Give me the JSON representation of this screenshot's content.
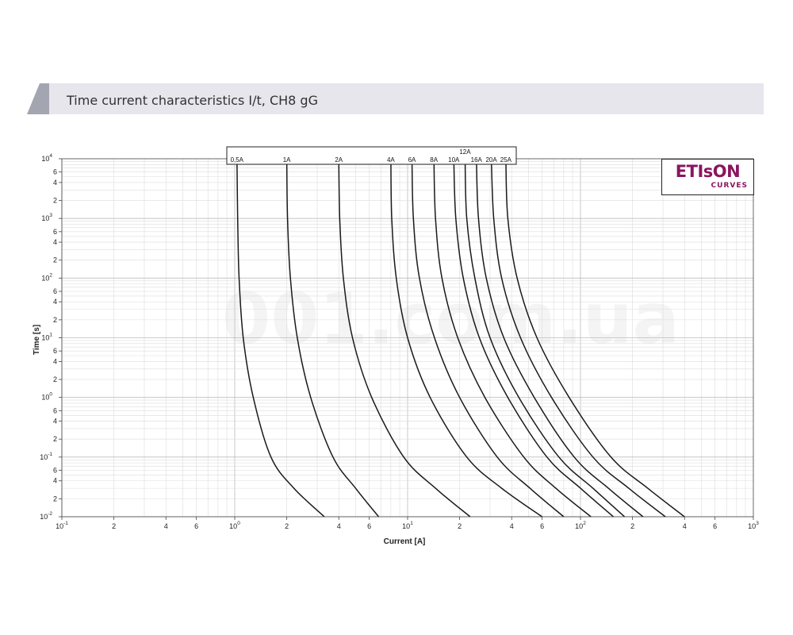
{
  "header": {
    "title": "Time current characteristics I/t, CH8 gG"
  },
  "logo": {
    "main": "ETIsON",
    "sub": "CURVES"
  },
  "watermark": "001.com.ua",
  "colors": {
    "header_bar": "#e6e6ec",
    "header_slant": "#a3a5b0",
    "curve": "#1a1a1a",
    "grid": "#dcdcdc",
    "logo": "#8a1560"
  },
  "chart_data": {
    "type": "line",
    "title": "",
    "xlabel": "Current [A]",
    "ylabel": "Time [s]",
    "xscale": "log",
    "yscale": "log",
    "xlim": [
      0.1,
      1000
    ],
    "ylim": [
      0.01,
      10000
    ],
    "grid": true,
    "x_ticks": [
      {
        "v": 0.1,
        "mant": "10",
        "exp": "-1"
      },
      {
        "v": 0.2,
        "mant": "2",
        "exp": ""
      },
      {
        "v": 0.4,
        "mant": "4",
        "exp": ""
      },
      {
        "v": 0.6,
        "mant": "6",
        "exp": ""
      },
      {
        "v": 1,
        "mant": "10",
        "exp": "0"
      },
      {
        "v": 2,
        "mant": "2",
        "exp": ""
      },
      {
        "v": 4,
        "mant": "4",
        "exp": ""
      },
      {
        "v": 6,
        "mant": "6",
        "exp": ""
      },
      {
        "v": 10,
        "mant": "10",
        "exp": "1"
      },
      {
        "v": 20,
        "mant": "2",
        "exp": ""
      },
      {
        "v": 40,
        "mant": "4",
        "exp": ""
      },
      {
        "v": 60,
        "mant": "6",
        "exp": ""
      },
      {
        "v": 100,
        "mant": "10",
        "exp": "2"
      },
      {
        "v": 200,
        "mant": "2",
        "exp": ""
      },
      {
        "v": 400,
        "mant": "4",
        "exp": ""
      },
      {
        "v": 600,
        "mant": "6",
        "exp": ""
      },
      {
        "v": 1000,
        "mant": "10",
        "exp": "3"
      }
    ],
    "y_ticks": [
      {
        "v": 0.01,
        "mant": "10",
        "exp": "-2"
      },
      {
        "v": 0.02,
        "mant": "2",
        "exp": ""
      },
      {
        "v": 0.04,
        "mant": "4",
        "exp": ""
      },
      {
        "v": 0.06,
        "mant": "6",
        "exp": ""
      },
      {
        "v": 0.1,
        "mant": "10",
        "exp": "-1"
      },
      {
        "v": 0.2,
        "mant": "2",
        "exp": ""
      },
      {
        "v": 0.4,
        "mant": "4",
        "exp": ""
      },
      {
        "v": 0.6,
        "mant": "6",
        "exp": ""
      },
      {
        "v": 1,
        "mant": "10",
        "exp": "0"
      },
      {
        "v": 2,
        "mant": "2",
        "exp": ""
      },
      {
        "v": 4,
        "mant": "4",
        "exp": ""
      },
      {
        "v": 6,
        "mant": "6",
        "exp": ""
      },
      {
        "v": 10,
        "mant": "10",
        "exp": "1"
      },
      {
        "v": 20,
        "mant": "2",
        "exp": ""
      },
      {
        "v": 40,
        "mant": "4",
        "exp": ""
      },
      {
        "v": 60,
        "mant": "6",
        "exp": ""
      },
      {
        "v": 100,
        "mant": "10",
        "exp": "2"
      },
      {
        "v": 200,
        "mant": "2",
        "exp": ""
      },
      {
        "v": 400,
        "mant": "4",
        "exp": ""
      },
      {
        "v": 600,
        "mant": "6",
        "exp": ""
      },
      {
        "v": 1000,
        "mant": "10",
        "exp": "3"
      },
      {
        "v": 2000,
        "mant": "2",
        "exp": ""
      },
      {
        "v": 4000,
        "mant": "4",
        "exp": ""
      },
      {
        "v": 6000,
        "mant": "6",
        "exp": ""
      },
      {
        "v": 10000,
        "mant": "10",
        "exp": "4"
      }
    ],
    "series": [
      {
        "name": "0,5A",
        "label_row": 0,
        "points": [
          [
            1.03,
            10000
          ],
          [
            1.04,
            1000
          ],
          [
            1.06,
            100
          ],
          [
            1.12,
            10
          ],
          [
            1.28,
            1
          ],
          [
            1.62,
            0.1
          ],
          [
            2.2,
            0.03
          ],
          [
            3.3,
            0.01
          ]
        ]
      },
      {
        "name": "1A",
        "label_row": 0,
        "points": [
          [
            2.0,
            10000
          ],
          [
            2.02,
            1000
          ],
          [
            2.1,
            100
          ],
          [
            2.3,
            10
          ],
          [
            2.75,
            1
          ],
          [
            3.7,
            0.1
          ],
          [
            5.0,
            0.03
          ],
          [
            6.8,
            0.01
          ]
        ]
      },
      {
        "name": "2A",
        "label_row": 0,
        "points": [
          [
            4.0,
            10000
          ],
          [
            4.05,
            1000
          ],
          [
            4.25,
            100
          ],
          [
            4.8,
            10
          ],
          [
            6.2,
            1
          ],
          [
            9.5,
            0.1
          ],
          [
            14.5,
            0.03
          ],
          [
            23,
            0.01
          ]
        ]
      },
      {
        "name": "4A",
        "label_row": 0,
        "points": [
          [
            8.0,
            10000
          ],
          [
            8.1,
            1000
          ],
          [
            8.6,
            100
          ],
          [
            10,
            10
          ],
          [
            13.5,
            1
          ],
          [
            22,
            0.1
          ],
          [
            35,
            0.03
          ],
          [
            60,
            0.01
          ]
        ]
      },
      {
        "name": "6A",
        "label_row": 0,
        "points": [
          [
            10.6,
            10000
          ],
          [
            10.8,
            1000
          ],
          [
            11.7,
            100
          ],
          [
            14.3,
            10
          ],
          [
            20,
            1
          ],
          [
            33,
            0.1
          ],
          [
            51,
            0.03
          ],
          [
            80,
            0.01
          ]
        ]
      },
      {
        "name": "8A",
        "label_row": 0,
        "points": [
          [
            14.2,
            10000
          ],
          [
            14.5,
            1000
          ],
          [
            15.8,
            100
          ],
          [
            19.5,
            10
          ],
          [
            28,
            1
          ],
          [
            47,
            0.1
          ],
          [
            72,
            0.03
          ],
          [
            115,
            0.01
          ]
        ]
      },
      {
        "name": "10A",
        "label_row": 0,
        "points": [
          [
            18.5,
            10000
          ],
          [
            19,
            1000
          ],
          [
            21,
            100
          ],
          [
            26,
            10
          ],
          [
            38,
            1
          ],
          [
            64,
            0.1
          ],
          [
            100,
            0.03
          ],
          [
            155,
            0.01
          ]
        ]
      },
      {
        "name": "12A",
        "label_row": 1,
        "points": [
          [
            21.5,
            10000
          ],
          [
            22,
            1000
          ],
          [
            24.5,
            100
          ],
          [
            30,
            10
          ],
          [
            44,
            1
          ],
          [
            75,
            0.1
          ],
          [
            118,
            0.03
          ],
          [
            180,
            0.01
          ]
        ]
      },
      {
        "name": "16A",
        "label_row": 0,
        "points": [
          [
            25,
            10000
          ],
          [
            25.7,
            1000
          ],
          [
            28.5,
            100
          ],
          [
            36,
            10
          ],
          [
            54,
            1
          ],
          [
            92,
            0.1
          ],
          [
            145,
            0.03
          ],
          [
            230,
            0.01
          ]
        ]
      },
      {
        "name": "20A",
        "label_row": 0,
        "points": [
          [
            30.5,
            10000
          ],
          [
            31.5,
            1000
          ],
          [
            35,
            100
          ],
          [
            45,
            10
          ],
          [
            68,
            1
          ],
          [
            118,
            0.1
          ],
          [
            190,
            0.03
          ],
          [
            310,
            0.01
          ]
        ]
      },
      {
        "name": "25A",
        "label_row": 0,
        "points": [
          [
            37,
            10000
          ],
          [
            38,
            1000
          ],
          [
            43,
            100
          ],
          [
            56,
            10
          ],
          [
            86,
            1
          ],
          [
            150,
            0.1
          ],
          [
            245,
            0.03
          ],
          [
            400,
            0.01
          ]
        ]
      }
    ]
  }
}
